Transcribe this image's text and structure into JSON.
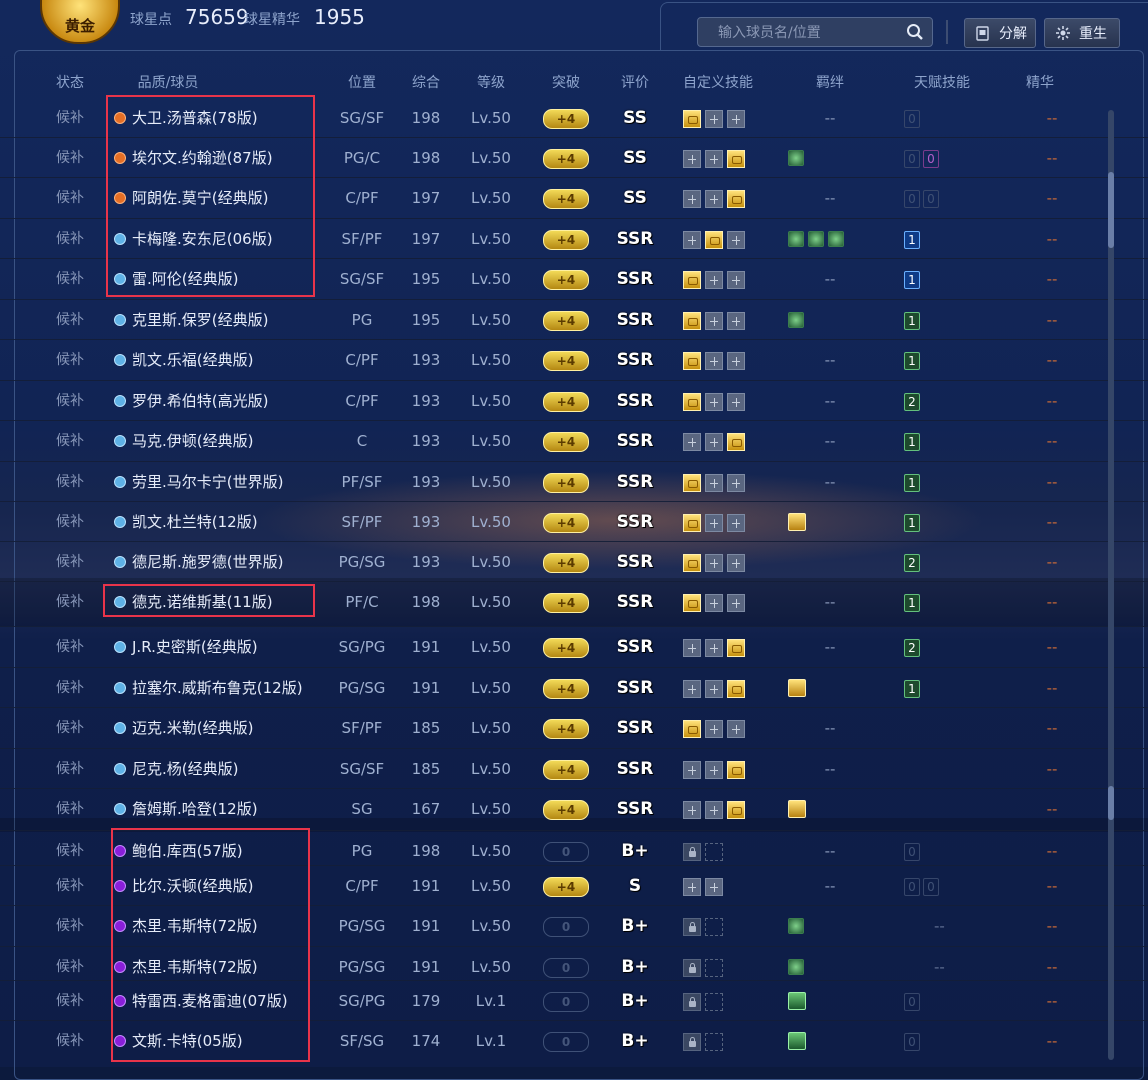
{
  "header_bar": {
    "badge_text": "黄金",
    "stat1_label": "球星点",
    "stat1_value": "75659",
    "stat2_label": "球星精华",
    "stat2_value": "1955",
    "search_placeholder": "输入球员名/位置",
    "decompose_label": "分解",
    "rebirth_label": "重生"
  },
  "columns": [
    "状态",
    "品质/球员",
    "位置",
    "综合",
    "等级",
    "突破",
    "评价",
    "自定义技能",
    "羁绊",
    "天赋技能",
    "精华"
  ],
  "rows": [
    {
      "status": "候补",
      "quality": "orange",
      "name": "大卫.汤普森(78版)",
      "pos": "SG/SF",
      "ovr": "198",
      "lvl": "Lv.50",
      "brk": "+4",
      "brk_on": true,
      "grade": "SS",
      "skills": [
        "gold",
        "plus",
        "plus"
      ],
      "bond": "--",
      "bond_icons": [],
      "talent": [
        {
          "t": "0",
          "c": "dim"
        }
      ],
      "ess": "--"
    },
    {
      "status": "候补",
      "quality": "orange",
      "name": "埃尔文.约翰逊(87版)",
      "pos": "PG/C",
      "ovr": "198",
      "lvl": "Lv.50",
      "brk": "+4",
      "brk_on": true,
      "grade": "SS",
      "skills": [
        "plus",
        "plus",
        "gold"
      ],
      "bond": "",
      "bond_icons": [
        "green"
      ],
      "talent": [
        {
          "t": "0",
          "c": "dim"
        },
        {
          "t": "0",
          "c": "pink"
        }
      ],
      "ess": "--"
    },
    {
      "status": "候补",
      "quality": "orange",
      "name": "阿朗佐.莫宁(经典版)",
      "pos": "C/PF",
      "ovr": "197",
      "lvl": "Lv.50",
      "brk": "+4",
      "brk_on": true,
      "grade": "SS",
      "skills": [
        "plus",
        "plus",
        "gold"
      ],
      "bond": "--",
      "bond_icons": [],
      "talent": [
        {
          "t": "0",
          "c": "dim"
        },
        {
          "t": "0",
          "c": "dim"
        }
      ],
      "ess": "--"
    },
    {
      "status": "候补",
      "quality": "blue",
      "name": "卡梅隆.安东尼(06版)",
      "pos": "SF/PF",
      "ovr": "197",
      "lvl": "Lv.50",
      "brk": "+4",
      "brk_on": true,
      "grade": "SSR",
      "skills": [
        "plus",
        "gold",
        "plus"
      ],
      "bond": "",
      "bond_icons": [
        "green",
        "green",
        "green"
      ],
      "talent": [
        {
          "t": "1",
          "c": "blue"
        }
      ],
      "ess": "--"
    },
    {
      "status": "候补",
      "quality": "blue",
      "name": "雷.阿伦(经典版)",
      "pos": "SG/SF",
      "ovr": "195",
      "lvl": "Lv.50",
      "brk": "+4",
      "brk_on": true,
      "grade": "SSR",
      "skills": [
        "gold",
        "plus",
        "plus"
      ],
      "bond": "--",
      "bond_icons": [],
      "talent": [
        {
          "t": "1",
          "c": "blue"
        }
      ],
      "ess": "--"
    },
    {
      "status": "候补",
      "quality": "blue",
      "name": "克里斯.保罗(经典版)",
      "pos": "PG",
      "ovr": "195",
      "lvl": "Lv.50",
      "brk": "+4",
      "brk_on": true,
      "grade": "SSR",
      "skills": [
        "gold",
        "plus",
        "plus"
      ],
      "bond": "",
      "bond_icons": [
        "green"
      ],
      "talent": [
        {
          "t": "1",
          "c": "green"
        }
      ],
      "ess": "--"
    },
    {
      "status": "候补",
      "quality": "blue",
      "name": "凯文.乐福(经典版)",
      "pos": "C/PF",
      "ovr": "193",
      "lvl": "Lv.50",
      "brk": "+4",
      "brk_on": true,
      "grade": "SSR",
      "skills": [
        "gold",
        "plus",
        "plus"
      ],
      "bond": "--",
      "bond_icons": [],
      "talent": [
        {
          "t": "1",
          "c": "green"
        }
      ],
      "ess": "--"
    },
    {
      "status": "候补",
      "quality": "blue",
      "name": "罗伊.希伯特(高光版)",
      "pos": "C/PF",
      "ovr": "193",
      "lvl": "Lv.50",
      "brk": "+4",
      "brk_on": true,
      "grade": "SSR",
      "skills": [
        "gold",
        "plus",
        "plus"
      ],
      "bond": "--",
      "bond_icons": [],
      "talent": [
        {
          "t": "2",
          "c": "green"
        }
      ],
      "ess": "--"
    },
    {
      "status": "候补",
      "quality": "blue",
      "name": "马克.伊顿(经典版)",
      "pos": "C",
      "ovr": "193",
      "lvl": "Lv.50",
      "brk": "+4",
      "brk_on": true,
      "grade": "SSR",
      "skills": [
        "plus",
        "plus",
        "gold"
      ],
      "bond": "--",
      "bond_icons": [],
      "talent": [
        {
          "t": "1",
          "c": "green"
        }
      ],
      "ess": "--"
    },
    {
      "status": "候补",
      "quality": "blue",
      "name": "劳里.马尔卡宁(世界版)",
      "pos": "PF/SF",
      "ovr": "193",
      "lvl": "Lv.50",
      "brk": "+4",
      "brk_on": true,
      "grade": "SSR",
      "skills": [
        "gold",
        "plus",
        "plus"
      ],
      "bond": "--",
      "bond_icons": [],
      "talent": [
        {
          "t": "1",
          "c": "green"
        }
      ],
      "ess": "--"
    },
    {
      "status": "候补",
      "quality": "blue",
      "name": "凯文.杜兰特(12版)",
      "pos": "SF/PF",
      "ovr": "193",
      "lvl": "Lv.50",
      "brk": "+4",
      "brk_on": true,
      "grade": "SSR",
      "skills": [
        "gold",
        "plus",
        "plus"
      ],
      "bond": "",
      "bond_icons": [
        "goldbox"
      ],
      "talent": [
        {
          "t": "1",
          "c": "green"
        }
      ],
      "ess": "--"
    },
    {
      "status": "候补",
      "quality": "blue",
      "name": "德尼斯.施罗德(世界版)",
      "pos": "PG/SG",
      "ovr": "193",
      "lvl": "Lv.50",
      "brk": "+4",
      "brk_on": true,
      "grade": "SSR",
      "skills": [
        "gold",
        "plus",
        "plus"
      ],
      "bond": "",
      "bond_icons": [],
      "talent": [
        {
          "t": "2",
          "c": "green"
        }
      ],
      "ess": "--"
    },
    {
      "status": "候补",
      "quality": "blue",
      "name": "德克.诺维斯基(11版)",
      "pos": "PF/C",
      "ovr": "198",
      "lvl": "Lv.50",
      "brk": "+4",
      "brk_on": true,
      "grade": "SSR",
      "skills": [
        "gold",
        "plus",
        "plus"
      ],
      "bond": "--",
      "bond_icons": [],
      "talent": [
        {
          "t": "1",
          "c": "green"
        }
      ],
      "ess": "--"
    },
    {
      "status": "候补",
      "quality": "blue",
      "name": "J.R.史密斯(经典版)",
      "pos": "SG/PG",
      "ovr": "191",
      "lvl": "Lv.50",
      "brk": "+4",
      "brk_on": true,
      "grade": "SSR",
      "skills": [
        "plus",
        "plus",
        "gold"
      ],
      "bond": "--",
      "bond_icons": [],
      "talent": [
        {
          "t": "2",
          "c": "green"
        }
      ],
      "ess": "--"
    },
    {
      "status": "候补",
      "quality": "blue",
      "name": "拉塞尔.威斯布鲁克(12版)",
      "pos": "PG/SG",
      "ovr": "191",
      "lvl": "Lv.50",
      "brk": "+4",
      "brk_on": true,
      "grade": "SSR",
      "skills": [
        "plus",
        "plus",
        "gold"
      ],
      "bond": "",
      "bond_icons": [
        "goldbox"
      ],
      "talent": [
        {
          "t": "1",
          "c": "green"
        }
      ],
      "ess": "--"
    },
    {
      "status": "候补",
      "quality": "blue",
      "name": "迈克.米勒(经典版)",
      "pos": "SF/PF",
      "ovr": "185",
      "lvl": "Lv.50",
      "brk": "+4",
      "brk_on": true,
      "grade": "SSR",
      "skills": [
        "gold",
        "plus",
        "plus"
      ],
      "bond": "--",
      "bond_icons": [],
      "talent": [],
      "ess": "--"
    },
    {
      "status": "候补",
      "quality": "blue",
      "name": "尼克.杨(经典版)",
      "pos": "SG/SF",
      "ovr": "185",
      "lvl": "Lv.50",
      "brk": "+4",
      "brk_on": true,
      "grade": "SSR",
      "skills": [
        "plus",
        "plus",
        "gold"
      ],
      "bond": "--",
      "bond_icons": [],
      "talent": [],
      "ess": "--"
    },
    {
      "status": "候补",
      "quality": "blue",
      "name": "詹姆斯.哈登(12版)",
      "pos": "SG",
      "ovr": "167",
      "lvl": "Lv.50",
      "brk": "+4",
      "brk_on": true,
      "grade": "SSR",
      "skills": [
        "plus",
        "plus",
        "gold"
      ],
      "bond": "",
      "bond_icons": [
        "goldbox"
      ],
      "talent": [],
      "ess": "--"
    },
    {
      "status": "候补",
      "quality": "purple",
      "name": "鲍伯.库西(57版)",
      "pos": "PG",
      "ovr": "198",
      "lvl": "Lv.50",
      "brk": "0",
      "brk_on": false,
      "grade": "B+",
      "skills": [
        "lock",
        "empty"
      ],
      "bond": "--",
      "bond_icons": [],
      "talent": [
        {
          "t": "0",
          "c": "dim"
        }
      ],
      "ess": "--"
    },
    {
      "status": "候补",
      "quality": "purple",
      "name": "比尔.沃顿(经典版)",
      "pos": "C/PF",
      "ovr": "191",
      "lvl": "Lv.50",
      "brk": "+4",
      "brk_on": true,
      "grade": "S",
      "skills": [
        "plus",
        "plus"
      ],
      "bond": "--",
      "bond_icons": [],
      "talent": [
        {
          "t": "0",
          "c": "dim"
        },
        {
          "t": "0",
          "c": "dim"
        }
      ],
      "ess": "--"
    },
    {
      "status": "候补",
      "quality": "purple",
      "name": "杰里.韦斯特(72版)",
      "pos": "PG/SG",
      "ovr": "191",
      "lvl": "Lv.50",
      "brk": "0",
      "brk_on": false,
      "grade": "B+",
      "skills": [
        "lock",
        "empty"
      ],
      "bond": "",
      "bond_icons": [
        "green"
      ],
      "talent": [],
      "talent_text": "--",
      "ess": "--"
    },
    {
      "status": "候补",
      "quality": "purple",
      "name": "杰里.韦斯特(72版)",
      "pos": "PG/SG",
      "ovr": "191",
      "lvl": "Lv.50",
      "brk": "0",
      "brk_on": false,
      "grade": "B+",
      "skills": [
        "lock",
        "empty"
      ],
      "bond": "",
      "bond_icons": [
        "green"
      ],
      "talent": [],
      "talent_text": "--",
      "ess": "--"
    },
    {
      "status": "候补",
      "quality": "purple",
      "name": "特雷西.麦格雷迪(07版)",
      "pos": "SG/PG",
      "ovr": "179",
      "lvl": "Lv.1",
      "brk": "0",
      "brk_on": false,
      "grade": "B+",
      "skills": [
        "lock",
        "empty"
      ],
      "bond": "",
      "bond_icons": [
        "greenbox"
      ],
      "talent": [
        {
          "t": "0",
          "c": "dim"
        }
      ],
      "ess": "--"
    },
    {
      "status": "候补",
      "quality": "purple",
      "name": "文斯.卡特(05版)",
      "pos": "SF/SG",
      "ovr": "174",
      "lvl": "Lv.1",
      "brk": "0",
      "brk_on": false,
      "grade": "B+",
      "skills": [
        "lock",
        "empty"
      ],
      "bond": "",
      "bond_icons": [
        "greenbox"
      ],
      "talent": [
        {
          "t": "0",
          "c": "dim"
        }
      ],
      "ess": "--"
    }
  ]
}
